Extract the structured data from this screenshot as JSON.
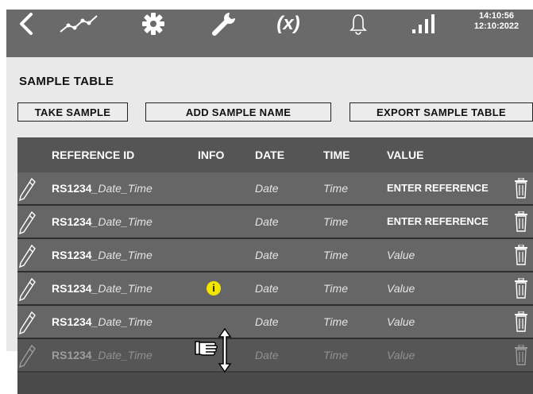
{
  "topbar": {
    "icons": [
      "back-chevron-icon",
      "trend-chart-icon",
      "gear-icon",
      "wrench-icon",
      "variable-icon",
      "bell-icon",
      "signal-icon"
    ],
    "fx_label": "(x)",
    "time": "14:10:56",
    "date": "12:10:2022"
  },
  "page": {
    "title": "SAMPLE TABLE"
  },
  "buttons": {
    "take_sample": "TAKE SAMPLE",
    "add_sample_name": "ADD SAMPLE NAME",
    "export_sample_table": "EXPORT SAMPLE TABLE"
  },
  "table": {
    "headers": {
      "reference_id": "REFERENCE ID",
      "info": "INFO",
      "date": "DATE",
      "time": "TIME",
      "value": "VALUE"
    },
    "rows": [
      {
        "ref": "RS1234",
        "ref_suffix": "_Date_Time",
        "info": "",
        "date": "Date",
        "time": "Time",
        "value": "ENTER REFERENCE"
      },
      {
        "ref": "RS1234",
        "ref_suffix": "_Date_Time",
        "info": "",
        "date": "Date",
        "time": "Time",
        "value": "ENTER REFERENCE"
      },
      {
        "ref": "RS1234",
        "ref_suffix": "_Date_Time",
        "info": "",
        "date": "Date",
        "time": "Time",
        "value": "Value"
      },
      {
        "ref": "RS1234",
        "ref_suffix": "_Date_Time",
        "info": "i",
        "date": "Date",
        "time": "Time",
        "value": "Value"
      },
      {
        "ref": "RS1234",
        "ref_suffix": "_Date_Time",
        "info": "",
        "date": "Date",
        "time": "Time",
        "value": "Value"
      },
      {
        "ref": "RS1234",
        "ref_suffix": "_Date_Time",
        "info": "",
        "date": "Date",
        "time": "Time",
        "value": "Value"
      }
    ]
  },
  "colors": {
    "topbar": "#6a6a6a",
    "background": "#e9e9e9",
    "table_row": "#666666",
    "info_badge": "#f2e600"
  }
}
